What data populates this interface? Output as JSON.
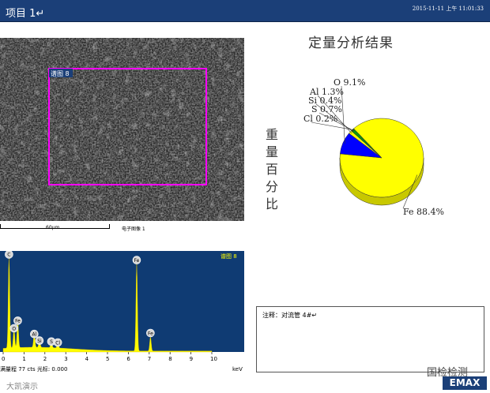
{
  "header": {
    "title": "项目 1↵",
    "timestamp": "2015-11-11 上午 11:01:33"
  },
  "sem": {
    "area_label": "谱图 8",
    "scale_label": "60µm",
    "image_caption": "电子图像 1"
  },
  "pie": {
    "title": "定量分析结果",
    "side_label": "重量百分比",
    "slices": [
      {
        "element": "Fe",
        "label": "Fe 88.4%",
        "percent": 88.4,
        "color": "#ffff00"
      },
      {
        "element": "O",
        "label": "O 9.1%",
        "percent": 9.1,
        "color": "#0000ff"
      },
      {
        "element": "Al",
        "label": "Al 1.3%",
        "percent": 1.3,
        "color": "#ffff00"
      },
      {
        "element": "Si",
        "label": "Si 0.4%",
        "percent": 0.4,
        "color": "#00b000"
      },
      {
        "element": "S",
        "label": "S 0.7%",
        "percent": 0.7,
        "color": "#00b000"
      },
      {
        "element": "Cl",
        "label": "Cl 0.2%",
        "percent": 0.2,
        "color": "#00b000"
      }
    ]
  },
  "spectrum": {
    "title": "谱图 8",
    "x_ticks": [
      "0",
      "1",
      "2",
      "3",
      "4",
      "5",
      "6",
      "7",
      "8",
      "9",
      "10"
    ],
    "unit": "keV",
    "footer": "满量程 77 cts 光标: 0.000",
    "peaks": [
      {
        "label": "C",
        "kev": 0.28,
        "height": 0.98
      },
      {
        "label": "O",
        "kev": 0.52,
        "height": 0.2
      },
      {
        "label": "Fe",
        "kev": 0.7,
        "height": 0.28
      },
      {
        "label": "Al",
        "kev": 1.49,
        "height": 0.14
      },
      {
        "label": "Si",
        "kev": 1.74,
        "height": 0.07
      },
      {
        "label": "S",
        "kev": 2.31,
        "height": 0.06
      },
      {
        "label": "Cl",
        "kev": 2.62,
        "height": 0.05
      },
      {
        "label": "Fe",
        "kev": 6.4,
        "height": 0.92
      },
      {
        "label": "Fe",
        "kev": 7.06,
        "height": 0.15
      }
    ]
  },
  "note": {
    "text": "注释：对流管 4#↵"
  },
  "watermarks": {
    "right": "国检检测",
    "left": "大凯演示"
  },
  "logo": "EMAX",
  "colors": {
    "header_bg": "#1b3f78",
    "spectrum_bg": "#0f3b73",
    "spectrum_fill": "#ffff00",
    "frame": "#ff00ff"
  }
}
